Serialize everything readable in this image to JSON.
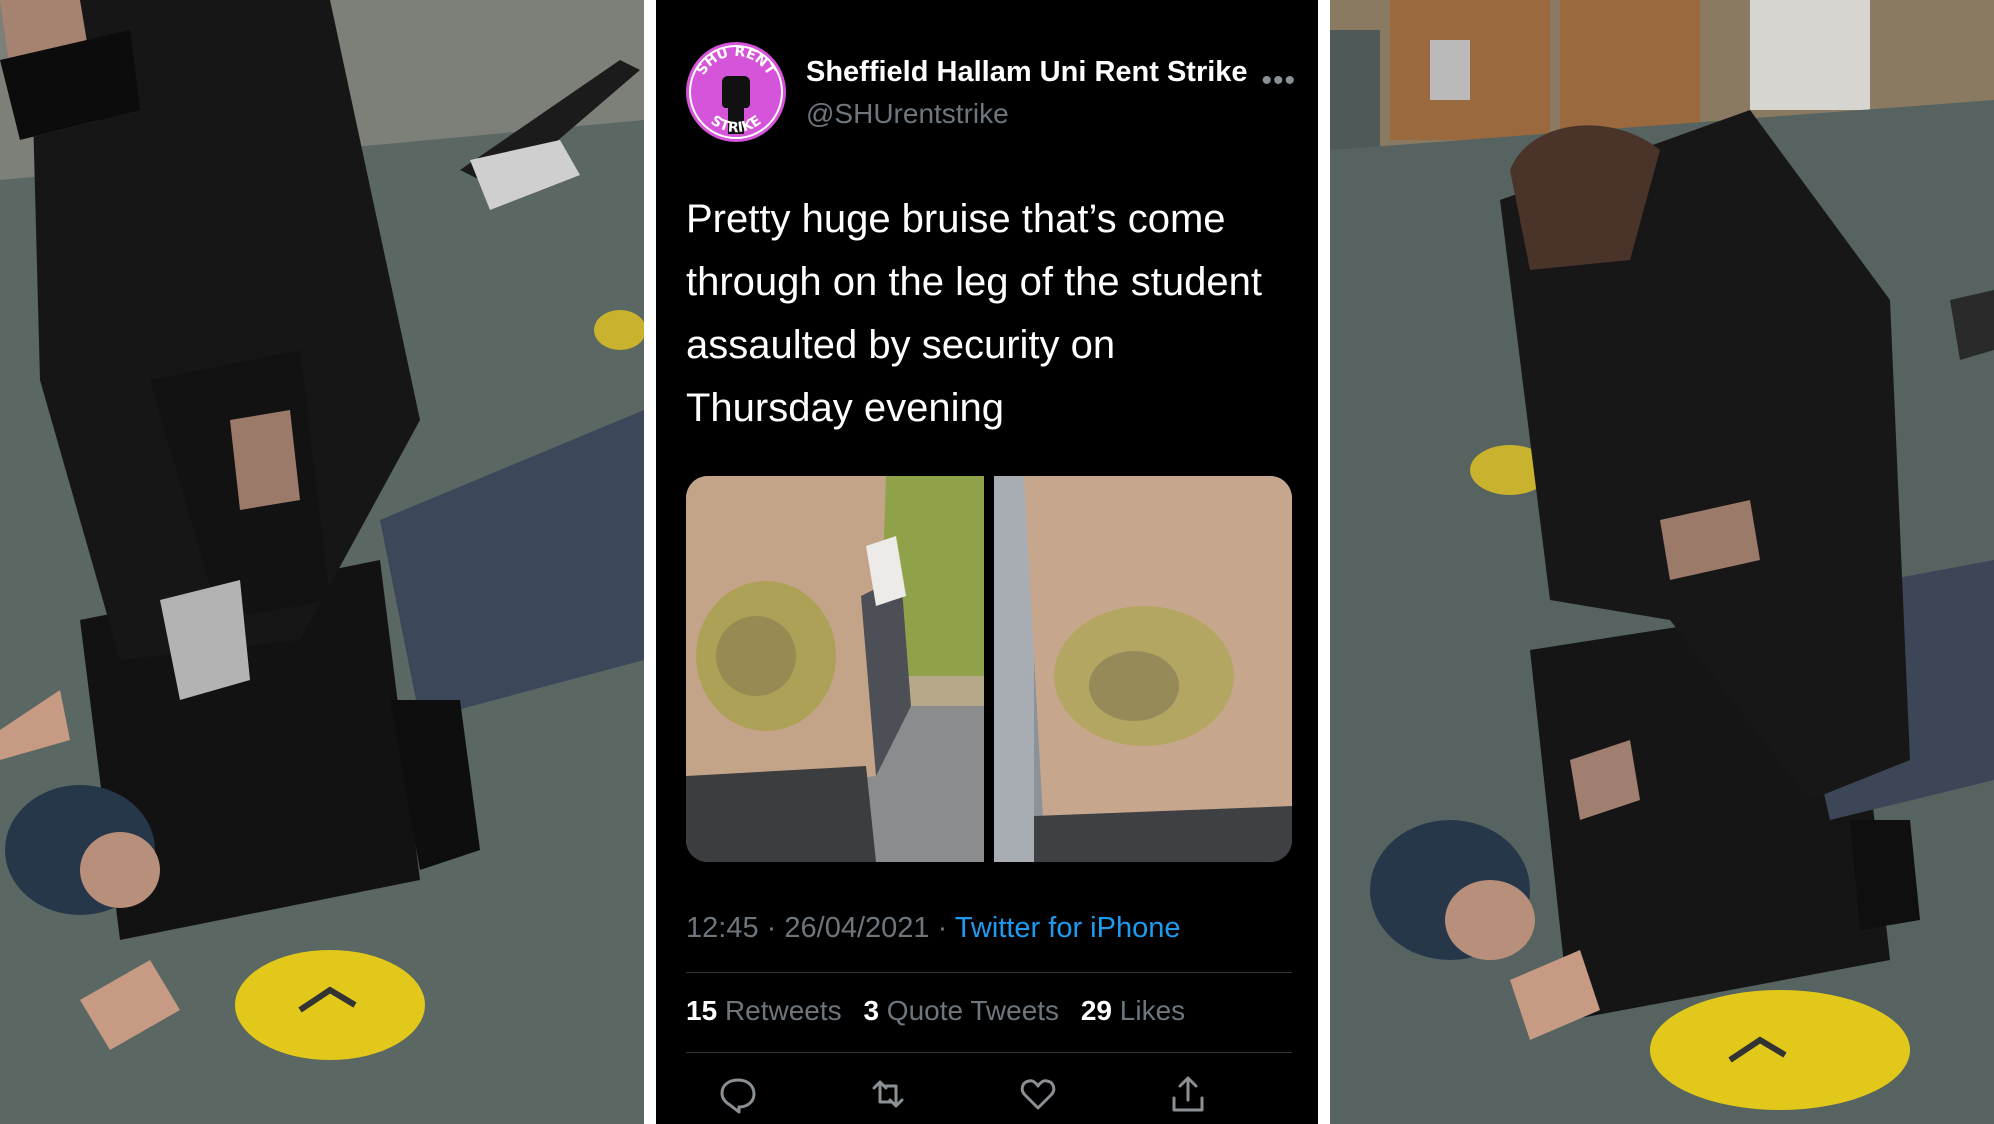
{
  "tweet": {
    "display_name": "Sheffield Hallam Uni Rent Strike",
    "handle": "@SHUrentstrike",
    "avatar_text": "SHU RENT STRIKE",
    "text": "Pretty huge bruise that’s come through on the leg of the student assaulted by security on Thursday evening",
    "time": "12:45",
    "date": "26/04/2021",
    "meta_separator": "·",
    "source": "Twitter for iPhone",
    "stats": {
      "retweets_count": "15",
      "retweets_label": "Retweets",
      "quotes_count": "3",
      "quotes_label": "Quote Tweets",
      "likes_count": "29",
      "likes_label": "Likes"
    },
    "icons": [
      "more-icon",
      "reply-icon",
      "retweet-icon",
      "like-icon",
      "share-icon"
    ]
  },
  "colors": {
    "background": "#000000",
    "text": "#ffffff",
    "secondary_text": "#6e767d",
    "link": "#1d9bf0",
    "avatar": "#d654d9"
  }
}
